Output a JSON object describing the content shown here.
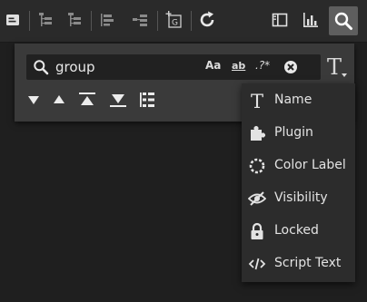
{
  "search": {
    "value": "group"
  },
  "search_options": {
    "match_case": "Aa",
    "whole_word": "ab",
    "regex": ".?*"
  },
  "filter_menu": {
    "items": [
      {
        "label": "Name",
        "icon": "text-icon"
      },
      {
        "label": "Plugin",
        "icon": "puzzle-icon"
      },
      {
        "label": "Color Label",
        "icon": "color-label-icon"
      },
      {
        "label": "Visibility",
        "icon": "eye-slash-icon"
      },
      {
        "label": "Locked",
        "icon": "lock-icon"
      },
      {
        "label": "Script Text",
        "icon": "code-icon"
      }
    ]
  },
  "colors": {
    "toolbar_bg": "#2a2a2a",
    "panel_bg": "#3a3a3a",
    "field_bg": "#212121",
    "menu_bg": "#2c2c2c",
    "active_button": "#5e5e5e"
  }
}
